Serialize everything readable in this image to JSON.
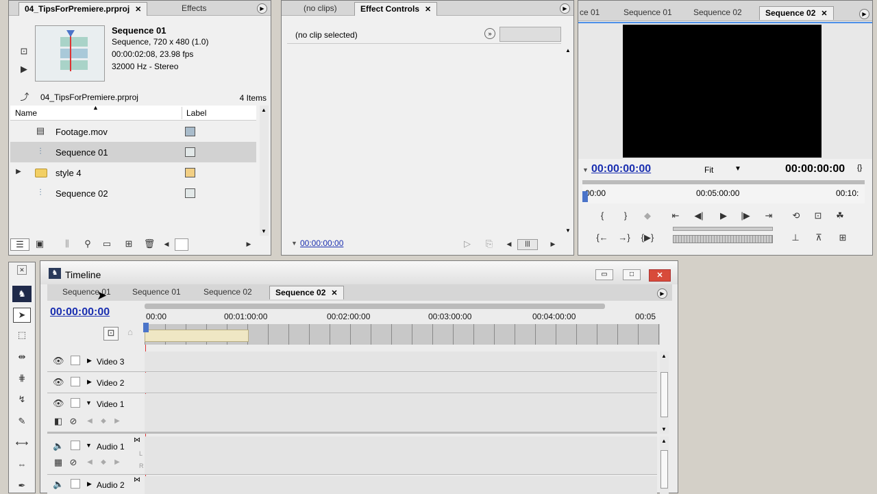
{
  "project": {
    "tabs": [
      "04_TipsForPremiere.prproj",
      "Effects"
    ],
    "close": "✕",
    "seq_name": "Sequence 01",
    "seq_info": "Sequence, 720 x 480 (1.0)",
    "seq_duration": "00:00:02:08, 23.98 fps",
    "seq_audio": "32000 Hz - Stereo",
    "path": "04_TipsForPremiere.prproj",
    "count": "4 Items",
    "col_name": "Name",
    "col_label": "Label",
    "items": [
      {
        "name": "Footage.mov",
        "icon": "film-icon",
        "color": "#a9bccb"
      },
      {
        "name": "Sequence 01",
        "icon": "sequence-icon",
        "color": "#e2e8e8"
      },
      {
        "name": "style 4",
        "icon": "folder-icon",
        "color": "#f2cf84"
      },
      {
        "name": "Sequence 02",
        "icon": "sequence-icon",
        "color": "#e2e8e8"
      }
    ]
  },
  "effects": {
    "tabs": [
      "(no clips)",
      "Effect Controls"
    ],
    "no_clip": "(no clip selected)",
    "timecode": "00:00:00:00"
  },
  "monitor": {
    "tabs": [
      "ce 01",
      "Sequence 01",
      "Sequence 02",
      "Sequence 02"
    ],
    "timecode": "00:00:00:00",
    "fit": "Fit",
    "duration": "00:00:00:00",
    "ruler": [
      "00:00",
      "00:05:00:00",
      "00:10:"
    ]
  },
  "timeline": {
    "title": "Timeline",
    "tabs": [
      "Sequence 01",
      "Sequence 01",
      "Sequence 02",
      "Sequence 02"
    ],
    "timecode": "00:00:00:00",
    "ruler": [
      "00:00",
      "00:01:00:00",
      "00:02:00:00",
      "00:03:00:00",
      "00:04:00:00",
      "00:05"
    ],
    "tracks": {
      "v3": "Video 3",
      "v2": "Video 2",
      "v1": "Video 1",
      "a1": "Audio 1",
      "a2": "Audio 2"
    },
    "lr": [
      "L",
      "R"
    ]
  }
}
